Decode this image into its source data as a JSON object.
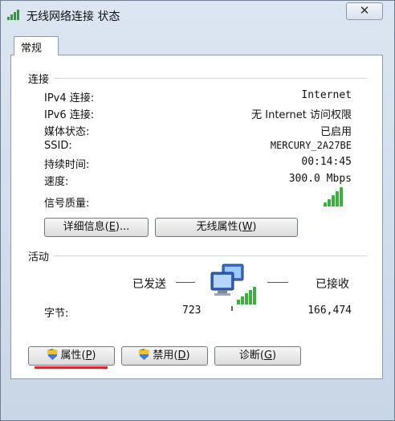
{
  "window": {
    "title": "无线网络连接 状态",
    "close_label": "✕"
  },
  "tabs": [
    {
      "label": "常规"
    }
  ],
  "connection": {
    "section_label": "连接",
    "rows": [
      {
        "label": "IPv4 连接:",
        "value": "Internet"
      },
      {
        "label": "IPv6 连接:",
        "value": "无 Internet 访问权限"
      },
      {
        "label": "媒体状态:",
        "value": "已启用"
      },
      {
        "label": "SSID:",
        "value": "MERCURY_2A27BE"
      },
      {
        "label": "持续时间:",
        "value": "00:14:45"
      },
      {
        "label": "速度:",
        "value": "300.0 Mbps"
      },
      {
        "label": "信号质量:",
        "value": ""
      }
    ],
    "signal_bars": 5,
    "signal_color": "#3fae3f",
    "details_button": {
      "text": "详细信息(",
      "key": "E",
      "suffix": ")..."
    },
    "wireless_props_button": {
      "text": "无线属性(",
      "key": "W",
      "suffix": ")"
    }
  },
  "activity": {
    "section_label": "活动",
    "sent_label": "已发送",
    "received_label": "已接收",
    "bytes_label": "字节:",
    "bytes_sent": "723",
    "bytes_received": "166,474",
    "icon": "network-computers-icon"
  },
  "buttons": {
    "properties": {
      "text": "属性(",
      "key": "P",
      "suffix": ")",
      "icon": "shield-icon"
    },
    "disable": {
      "text": "禁用(",
      "key": "D",
      "suffix": ")",
      "icon": "shield-icon"
    },
    "diagnose": {
      "text": "诊断(",
      "key": "G",
      "suffix": ")"
    }
  },
  "highlight_color": "#e0252c"
}
